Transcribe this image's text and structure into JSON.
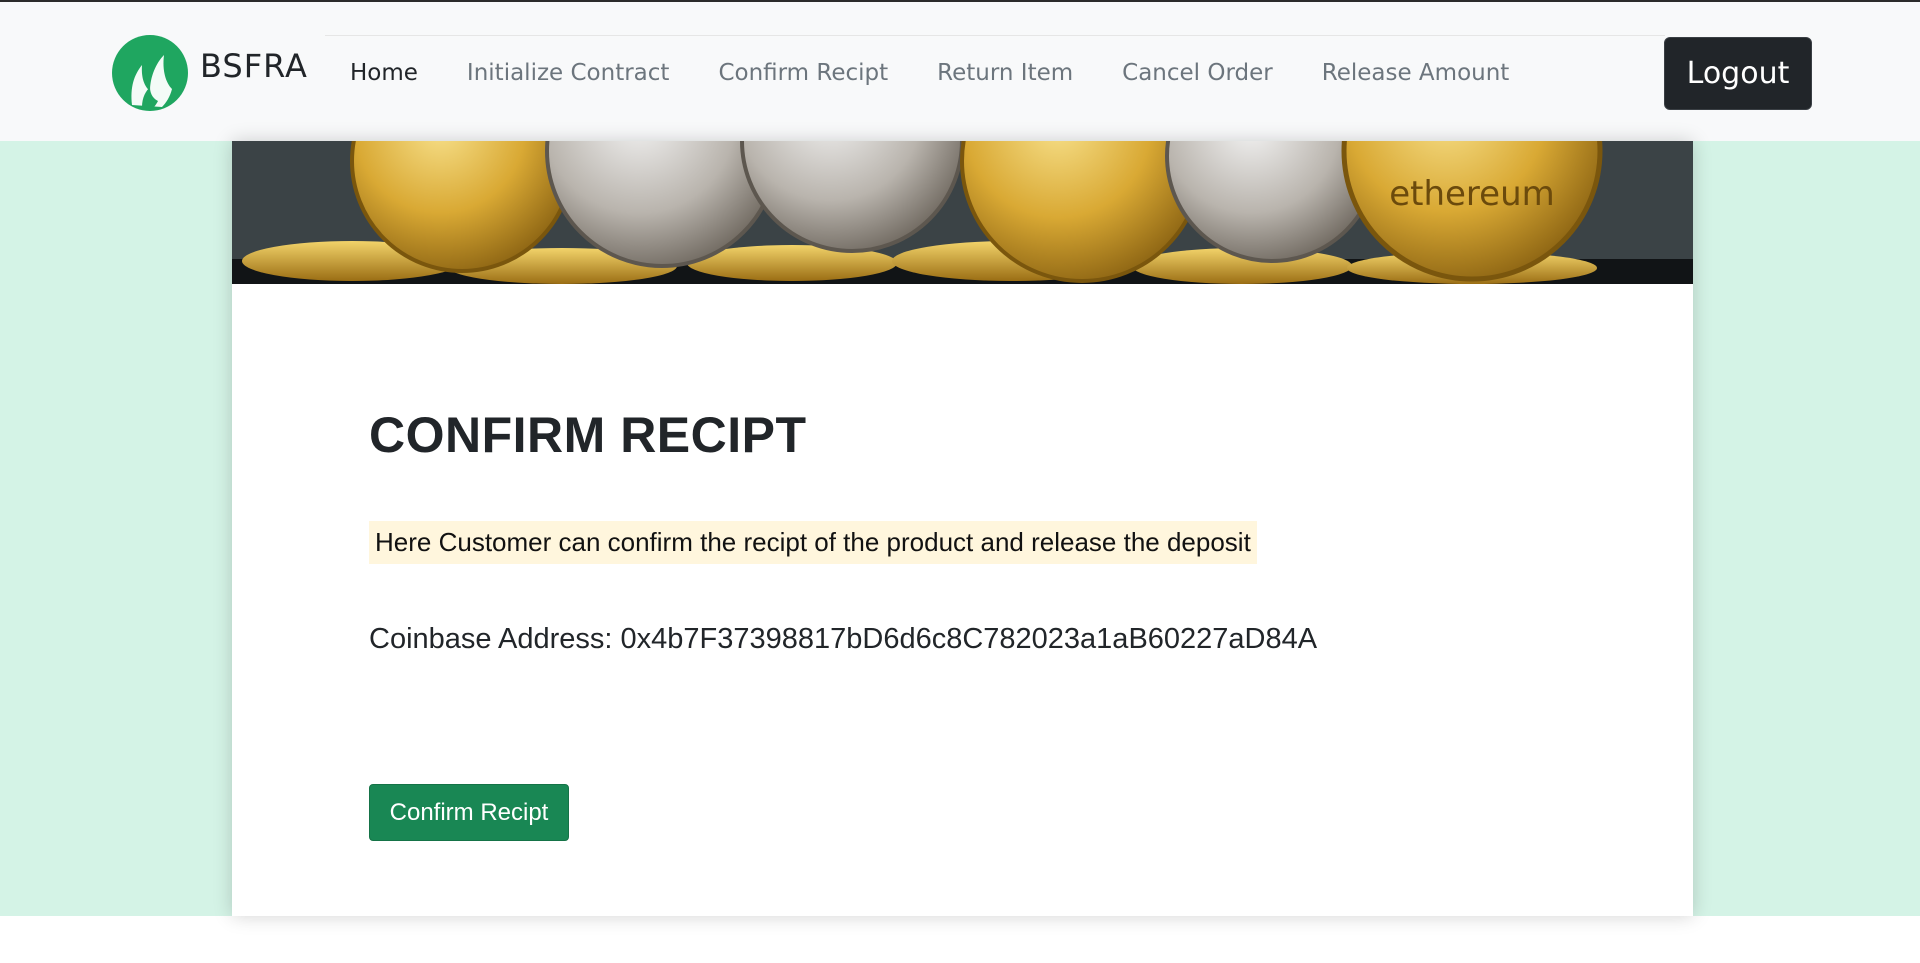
{
  "brand": {
    "name": "BSFRA",
    "logo_icon": "leaf-flame-logo",
    "logo_color": "#1fa660"
  },
  "nav": {
    "items": [
      {
        "label": "Home",
        "active": true
      },
      {
        "label": "Initialize Contract",
        "active": false
      },
      {
        "label": "Confirm Recipt",
        "active": false
      },
      {
        "label": "Return Item",
        "active": false
      },
      {
        "label": "Cancel Order",
        "active": false
      },
      {
        "label": "Release Amount",
        "active": false
      }
    ],
    "logout_label": "Logout"
  },
  "banner": {
    "image": "cryptocurrency-coins-banner",
    "coin_text": "ethereum"
  },
  "main": {
    "title": "CONFIRM RECIPT",
    "description": "Here Customer can confirm the recipt of the product and release the deposit",
    "address_label": "Coinbase Address:",
    "address_value": "0x4b7F37398817bD6d6c8C782023a1aB60227aD84A",
    "confirm_button": "Confirm Recipt"
  },
  "colors": {
    "page_background": "#d4f3e6",
    "navbar_background": "#f8f9fa",
    "logout_button": "#212529",
    "confirm_button": "#198754",
    "description_highlight": "#fff6dd"
  }
}
